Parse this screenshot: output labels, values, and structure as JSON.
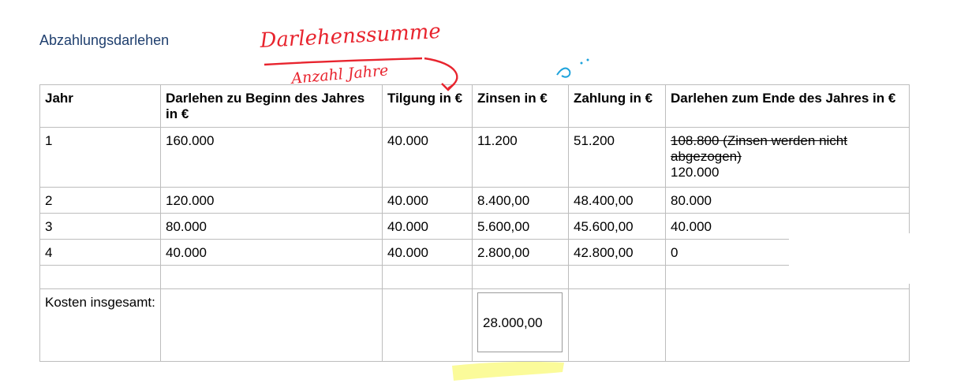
{
  "title": "Abzahlungsdarlehen",
  "annotations": {
    "numerator": "Darlehenssumme",
    "denominator": "Anzahl Jahre",
    "colors": {
      "ink_red": "#e8242e",
      "ink_blue": "#1ea3dc",
      "highlight_yellow": "#fbfb9a"
    }
  },
  "table": {
    "headers": [
      "Jahr",
      "Darlehen zu Beginn des Jahres in €",
      "Tilgung in €",
      "Zinsen in €",
      "Zahlung in €",
      "Darlehen zum Ende des Jahres in €"
    ],
    "row1": {
      "jahr": "1",
      "beginn": "160.000",
      "tilgung": "40.000",
      "zinsen": "11.200",
      "zahlung": "51.200",
      "ende_struck": "108.800 (Zinsen werden nicht abgezogen)",
      "ende": "120.000"
    },
    "rows": [
      [
        "2",
        "120.000",
        "40.000",
        "8.400,00",
        "48.400,00",
        "80.000"
      ],
      [
        "3",
        "80.000",
        "40.000",
        "5.600,00",
        "45.600,00",
        "40.000"
      ],
      [
        "4",
        "40.000",
        "40.000",
        "2.800,00",
        "42.800,00",
        "0"
      ]
    ],
    "cost_label": "Kosten insgesamt:",
    "cost_total": "28.000,00"
  }
}
